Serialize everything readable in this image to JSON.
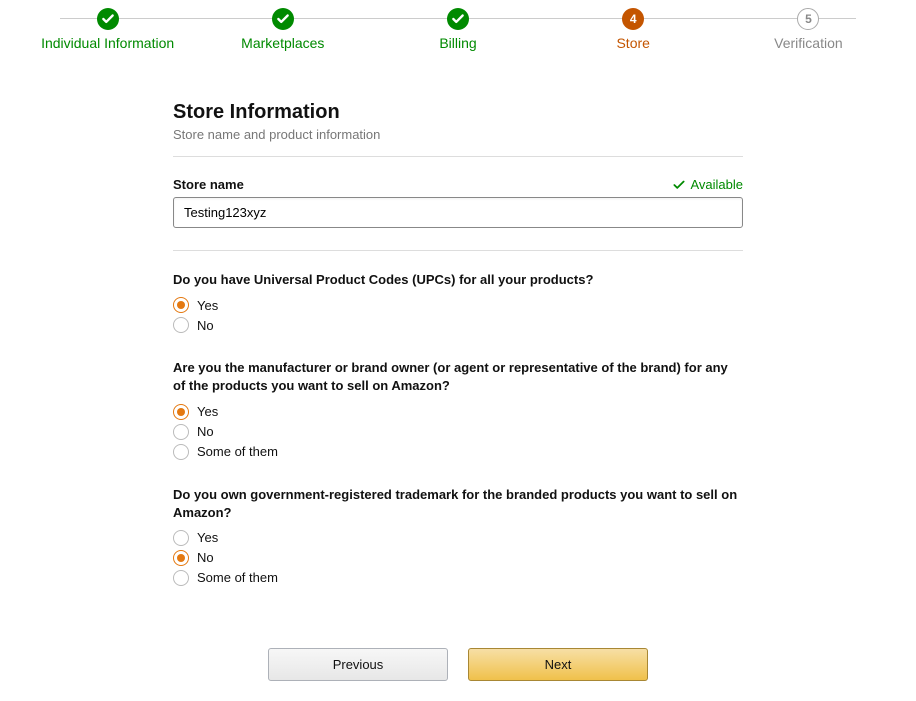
{
  "stepper": {
    "steps": [
      {
        "label": "Individual Information",
        "state": "done"
      },
      {
        "label": "Marketplaces",
        "state": "done"
      },
      {
        "label": "Billing",
        "state": "done"
      },
      {
        "label": "Store",
        "state": "active",
        "num": "4"
      },
      {
        "label": "Verification",
        "state": "future",
        "num": "5"
      }
    ]
  },
  "header": {
    "title": "Store Information",
    "subtitle": "Store name and product information"
  },
  "storeName": {
    "label": "Store name",
    "value": "Testing123xyz",
    "availableText": "Available"
  },
  "questions": {
    "upc": {
      "text": "Do you have Universal Product Codes (UPCs) for all your products?",
      "options": {
        "yes": "Yes",
        "no": "No"
      },
      "selected": "yes"
    },
    "brand": {
      "text": "Are you the manufacturer or brand owner (or agent or representative of the brand) for any of the products you want to sell on Amazon?",
      "options": {
        "yes": "Yes",
        "no": "No",
        "some": "Some of them"
      },
      "selected": "yes"
    },
    "trademark": {
      "text": "Do you own government-registered trademark for the branded products you want to sell on Amazon?",
      "options": {
        "yes": "Yes",
        "no": "No",
        "some": "Some of them"
      },
      "selected": "no"
    }
  },
  "buttons": {
    "previous": "Previous",
    "next": "Next"
  }
}
